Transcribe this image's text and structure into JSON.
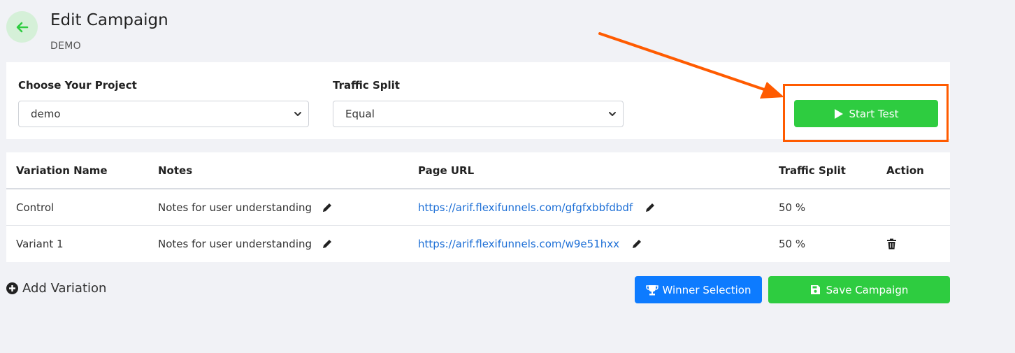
{
  "header": {
    "title": "Edit Campaign",
    "subtitle": "DEMO",
    "back_icon": "arrow-left-icon"
  },
  "form": {
    "project_label": "Choose Your Project",
    "project_value": "demo",
    "traffic_label": "Traffic Split",
    "traffic_value": "Equal",
    "start_test_label": "Start Test"
  },
  "table": {
    "headers": [
      "Variation Name",
      "Notes",
      "Page URL",
      "Traffic Split",
      "Action"
    ],
    "rows": [
      {
        "name": "Control",
        "notes": "Notes for user understanding",
        "url": "https://arif.flexifunnels.com/gfgfxbbfdbdf",
        "split": "50 %",
        "action": ""
      },
      {
        "name": "Variant 1",
        "notes": "Notes for user understanding",
        "url": "https://arif.flexifunnels.com/w9e51hxx",
        "split": "50 %",
        "action": "trash-icon"
      }
    ]
  },
  "footer": {
    "add_variation_label": "Add Variation",
    "winner_label": "Winner Selection",
    "save_label": "Save Campaign"
  },
  "colors": {
    "accent_green": "#2ecc40",
    "accent_blue": "#0d7bff",
    "annotation_orange": "#ff5b00",
    "link_blue": "#1d6fd6"
  }
}
